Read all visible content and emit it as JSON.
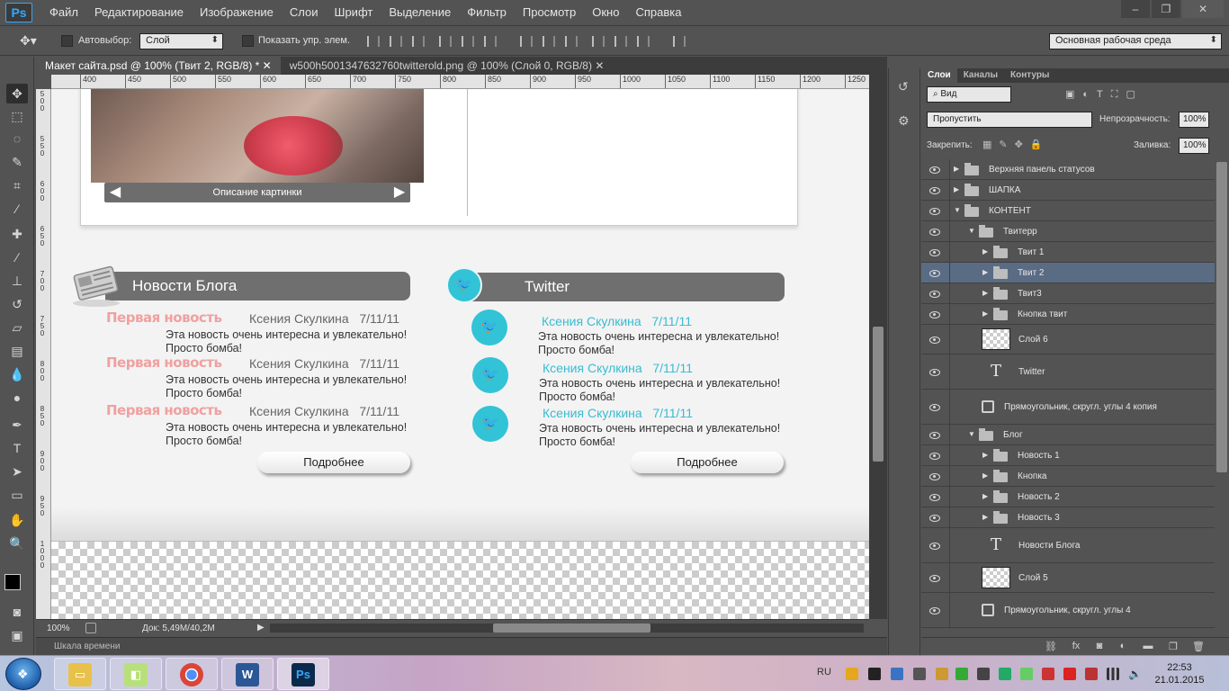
{
  "app": {
    "logo": "Ps"
  },
  "menu": [
    "Файл",
    "Редактирование",
    "Изображение",
    "Слои",
    "Шрифт",
    "Выделение",
    "Фильтр",
    "Просмотр",
    "Окно",
    "Справка"
  ],
  "options": {
    "autoselect_label": "Автовыбор:",
    "autoselect_value": "Слой",
    "show_controls_label": "Показать упр. элем.",
    "workspace": "Основная рабочая среда"
  },
  "tabs": [
    {
      "label": "Макет сайта.psd @ 100% (Твит 2, RGB/8) *",
      "active": true
    },
    {
      "label": "w500h5001347632760twitterold.png @ 100% (Слой 0, RGB/8)",
      "active": false
    }
  ],
  "ruler": {
    "top": [
      "400",
      "450",
      "500",
      "550",
      "600",
      "650",
      "700",
      "750",
      "800",
      "850",
      "900",
      "950",
      "1000",
      "1050",
      "1100",
      "1150",
      "1200",
      "1250"
    ],
    "left": [
      "5\n0\n0",
      "5\n5\n0",
      "6\n0\n0",
      "6\n5\n0",
      "7\n0\n0",
      "7\n5\n0",
      "8\n0\n0",
      "8\n5\n0",
      "9\n0\n0",
      "9\n5\n0",
      "1\n0\n0\n0"
    ]
  },
  "canvas": {
    "caption": "Описание картинки",
    "blog": {
      "title": "Новости Блога",
      "items": [
        {
          "title": "Первая новость",
          "meta": "Ксения Скулкина   7/11/11",
          "body1": "Эта новость очень интересна и увлекательно!",
          "body2": "Просто бомба!"
        },
        {
          "title": "Первая новость",
          "meta": "Ксения Скулкина   7/11/11",
          "body1": "Эта новость очень интересна и увлекательно!",
          "body2": "Просто бомба!"
        },
        {
          "title": "Первая новость",
          "meta": "Ксения Скулкина   7/11/11",
          "body1": "Эта новость очень интересна и увлекательно!",
          "body2": "Просто бомба!"
        }
      ],
      "more": "Подробнее"
    },
    "twitter": {
      "title": "Twitter",
      "items": [
        {
          "meta": "Ксения Скулкина   7/11/11",
          "body1": "Эта новость очень интересна и увлекательно!",
          "body2": "Просто бомба!"
        },
        {
          "meta": "Ксения Скулкина   7/11/11",
          "body1": "Эта новость очень интересна и увлекательно!",
          "body2": "Просто бомба!"
        },
        {
          "meta": "Ксения Скулкина   7/11/11",
          "body1": "Эта новость очень интересна и увлекательно!",
          "body2": "Просто бомба!"
        }
      ],
      "more": "Подробнее"
    }
  },
  "status": {
    "zoom": "100%",
    "doc": "Док: 5,49M/40,2M"
  },
  "timeline": "Шкала времени",
  "layers_panel": {
    "tabs": [
      "Слои",
      "Каналы",
      "Контуры"
    ],
    "filter": "Вид",
    "blend": "Пропустить",
    "opacity_label": "Непрозрачность:",
    "opacity": "100%",
    "lock_label": "Закрепить:",
    "fill_label": "Заливка:",
    "fill": "100%",
    "layers": [
      {
        "name": "Верхняя панель статусов",
        "type": "group"
      },
      {
        "name": "ШАПКА",
        "type": "group"
      },
      {
        "name": "КОНТЕНТ",
        "type": "group-open"
      },
      {
        "name": "Твитерр",
        "type": "group-open"
      },
      {
        "name": "Твит 1",
        "type": "group"
      },
      {
        "name": "Твит 2",
        "type": "group"
      },
      {
        "name": "Твит3",
        "type": "group"
      },
      {
        "name": "Кнопка твит",
        "type": "group"
      },
      {
        "name": "Слой 6",
        "type": "raster"
      },
      {
        "name": "Twitter",
        "type": "text"
      },
      {
        "name": "Прямоугольник, скругл. углы 4 копия",
        "type": "shape"
      },
      {
        "name": "Блог",
        "type": "group-open"
      },
      {
        "name": "Новость 1",
        "type": "group"
      },
      {
        "name": "Кнопка",
        "type": "group"
      },
      {
        "name": "Новость 2",
        "type": "group"
      },
      {
        "name": "Новость 3",
        "type": "group"
      },
      {
        "name": "Новости Блога",
        "type": "text"
      },
      {
        "name": "Слой 5",
        "type": "raster"
      },
      {
        "name": "Прямоугольник, скругл. углы 4",
        "type": "shape"
      }
    ]
  },
  "taskbar": {
    "lang": "RU",
    "time": "22:53",
    "date": "21.01.2015",
    "apps": [
      "explorer",
      "sticky-notes",
      "chrome",
      "word",
      "photoshop"
    ]
  },
  "colors": {
    "accent_twitter": "#32c3d6",
    "news_title": "#f0a0a0",
    "panel_bg": "#535353",
    "selected_layer": "#5a6b84"
  }
}
